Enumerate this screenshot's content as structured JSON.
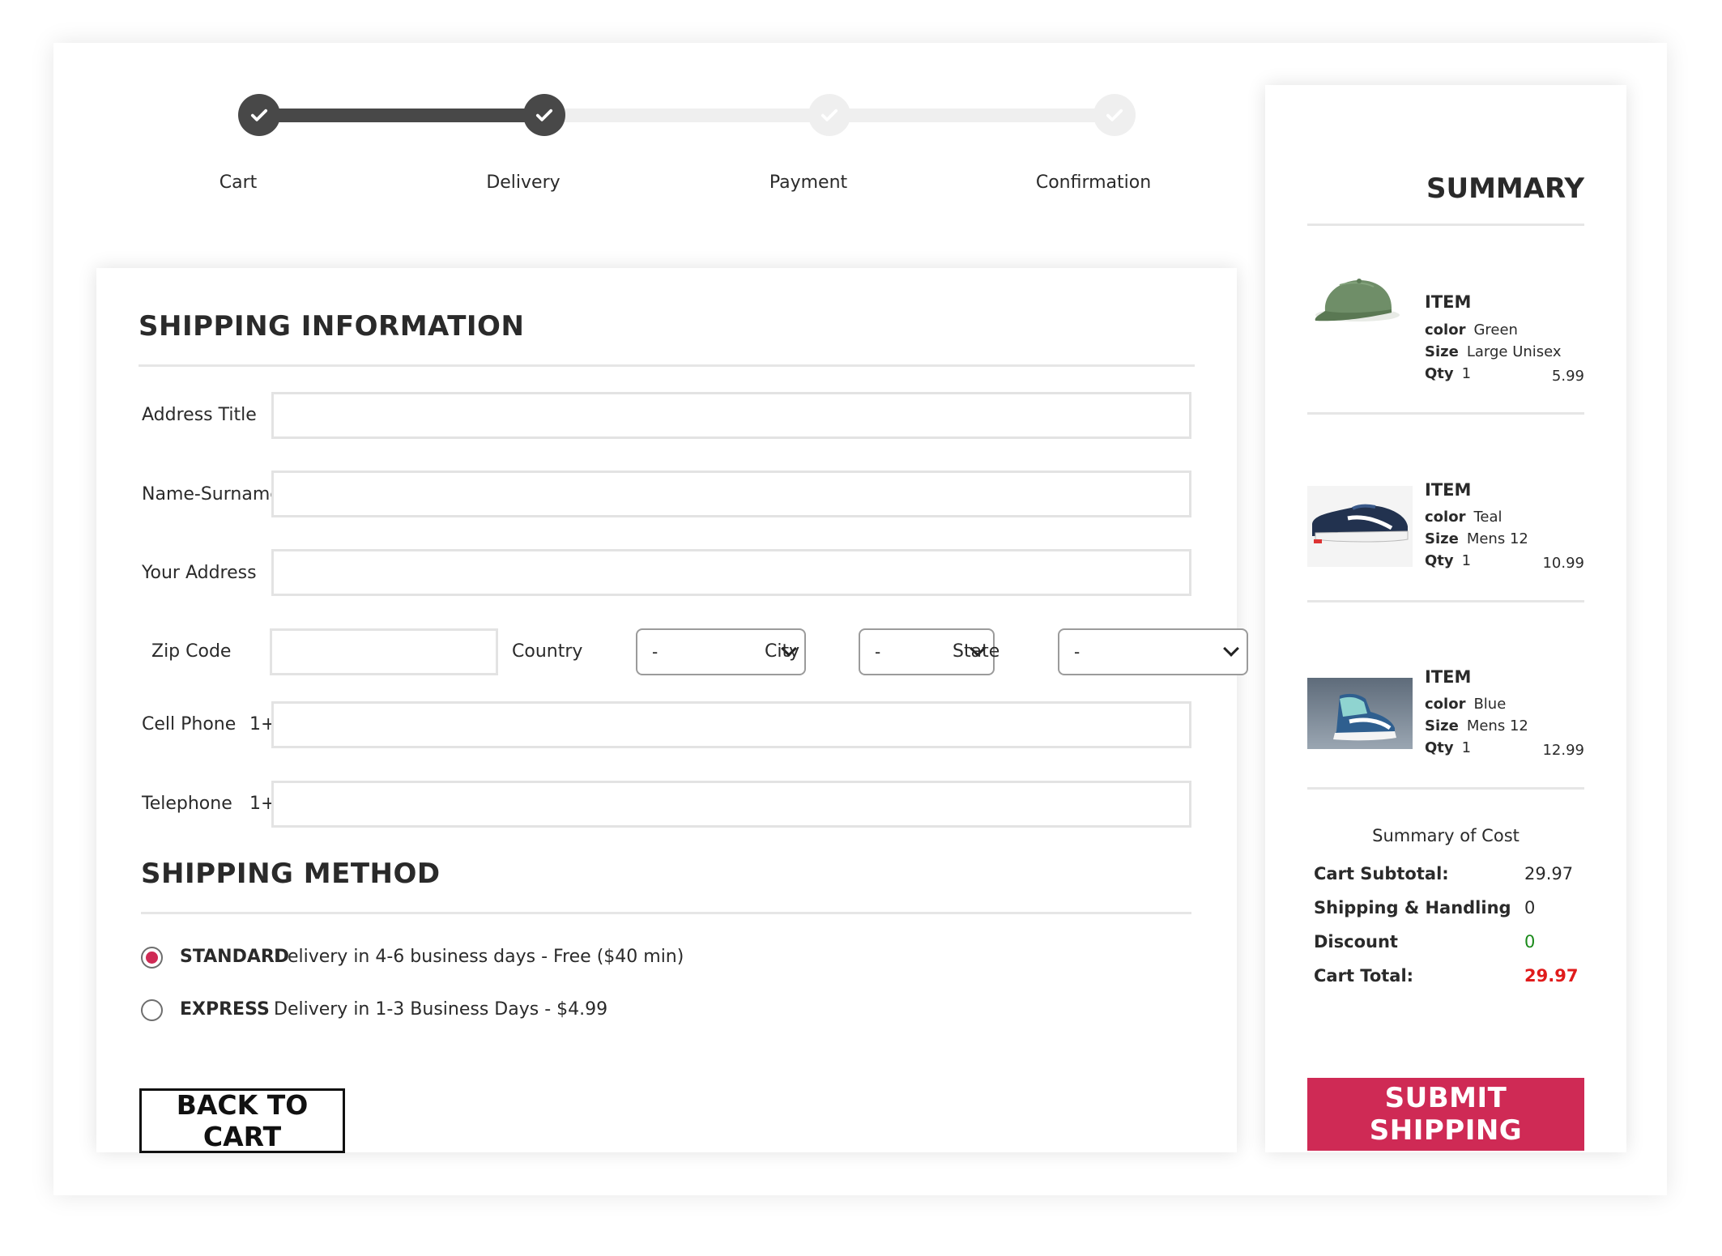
{
  "stepper": {
    "steps": [
      {
        "label": "Cart",
        "status": "done"
      },
      {
        "label": "Delivery",
        "status": "done"
      },
      {
        "label": "Payment",
        "status": "todo"
      },
      {
        "label": "Confirmation",
        "status": "todo"
      }
    ]
  },
  "shipping": {
    "title": "SHIPPING INFORMATION",
    "address_title_label": "Address Title",
    "address_title_value": "",
    "name_label": "Name-Surname",
    "name_value": "",
    "address_label": "Your Address",
    "address_value": "",
    "zip_label": "Zip Code",
    "zip_value": "",
    "country_label": "Country",
    "country_value": "-",
    "city_label": "City",
    "city_value": "-",
    "state_label": "State",
    "state_value": "-",
    "cell_label": "Cell Phone",
    "cell_prefix": "1+",
    "cell_value": "",
    "telephone_label": "Telephone",
    "telephone_prefix": "1+",
    "telephone_value": ""
  },
  "method": {
    "title": "SHIPPING METHOD",
    "options": [
      {
        "name": "STANDARD",
        "desc": "Delivery in 4-6 business days - Free ($40 min)",
        "selected": true
      },
      {
        "name": "EXPRESS",
        "desc": "Delivery in 1-3 Business Days - $4.99",
        "selected": false
      }
    ]
  },
  "back_button": "BACK TO CART",
  "summary": {
    "title": "SUMMARY",
    "items": [
      {
        "title": "ITEM",
        "color_label": "color",
        "color": "Green",
        "size_label": "Size",
        "size": "Large Unisex",
        "qty_label": "Qty",
        "qty": "1",
        "price": "5.99",
        "image": "green-cap"
      },
      {
        "title": "ITEM",
        "color_label": "color",
        "color": "Teal",
        "size_label": "Size",
        "size": "Mens 12",
        "qty_label": "Qty",
        "qty": "1",
        "price": "10.99",
        "image": "navy-sneaker"
      },
      {
        "title": "ITEM",
        "color_label": "color",
        "color": "Blue",
        "size_label": "Size",
        "size": "Mens 12",
        "qty_label": "Qty",
        "qty": "1",
        "price": "12.99",
        "image": "blue-high-top-sneaker"
      }
    ],
    "cost_title": "Summary of Cost",
    "subtotal_label": "Cart Subtotal:",
    "subtotal": "29.97",
    "shipping_label": "Shipping & Handling",
    "shipping": "0",
    "discount_label": "Discount",
    "discount": "0",
    "total_label": "Cart Total:",
    "total": "29.97"
  },
  "submit_button": "SUBMIT SHIPPING",
  "colors": {
    "accent": "#cf2a55",
    "step_done": "#484848",
    "step_todo": "#efefef",
    "discount": "#1a8a1a",
    "total": "#e01b1b"
  }
}
